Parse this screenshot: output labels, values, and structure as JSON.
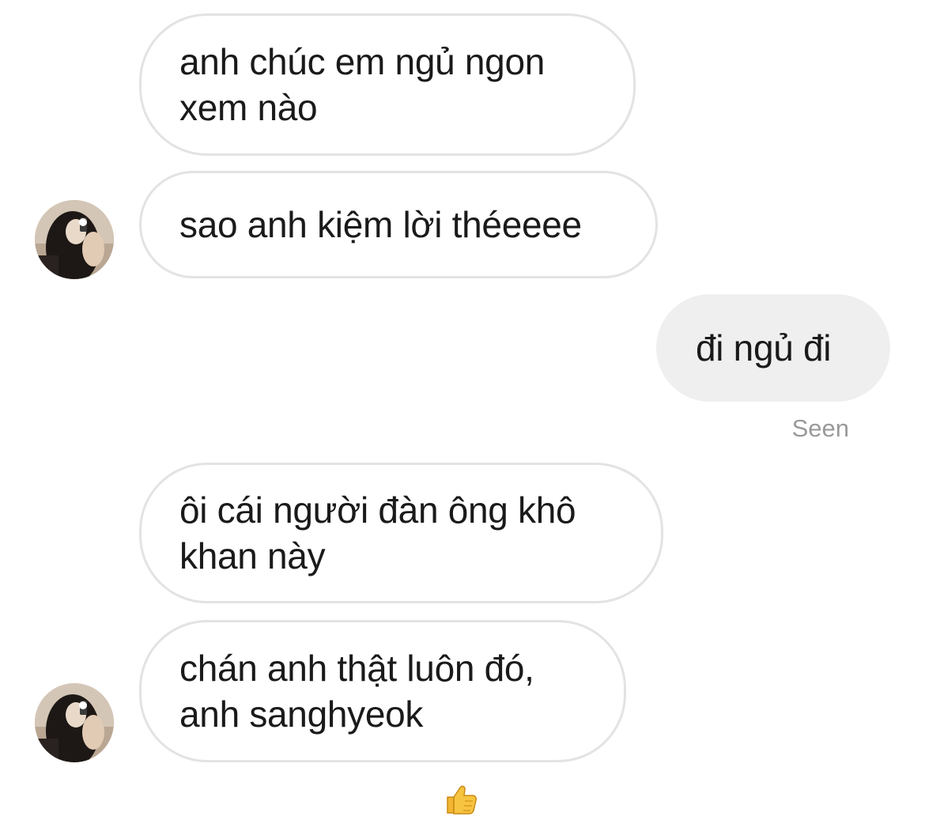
{
  "conversation": {
    "messages": [
      {
        "side": "incoming",
        "text": "anh chúc em ngủ ngon\nxem nào"
      },
      {
        "side": "incoming",
        "text": "sao anh kiệm lời théeeee"
      },
      {
        "side": "outgoing",
        "text": "đi ngủ đi"
      },
      {
        "side": "incoming",
        "text": "ôi cái người đàn ông khô\nkhan này"
      },
      {
        "side": "incoming",
        "text": "chán anh thật luôn đó,\nanh sanghyeok"
      }
    ],
    "status": "Seen",
    "reaction_icon": "thumbs-up-icon"
  },
  "colors": {
    "incoming_border": "#e3e3e3",
    "outgoing_bg": "#efefef",
    "status_text": "#9a9a9a"
  }
}
